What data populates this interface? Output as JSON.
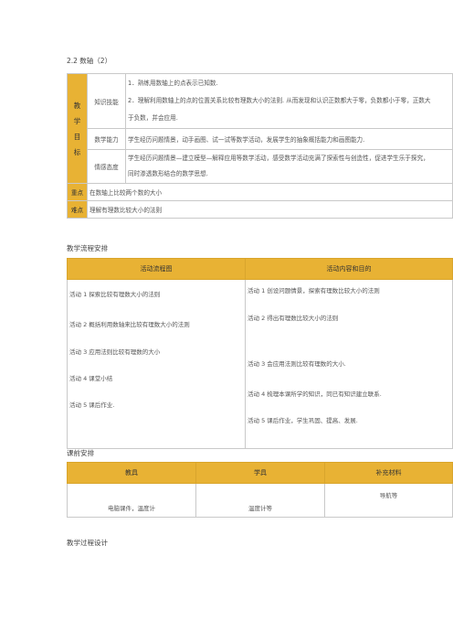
{
  "title": "2.2 数轴（2）",
  "goals": {
    "goal_label": "教学目标",
    "goal_chars": [
      "教",
      "学",
      "目",
      "标"
    ],
    "knowledge": {
      "label": "知识技能",
      "items": [
        "1．熟练用数轴上的点表示已知数.",
        "2．理解利用数轴上的点的位置关系比较有理数大小的法则. 从而发现和认识正数都大于零，负数都小于零，正数大",
        "于负数，并会应用."
      ]
    },
    "math_ability": {
      "label": "数学能力",
      "text": "学生经历问题情景，动手画图、试一试等数学活动，发展学生的抽象概括能力和画图能力."
    },
    "attitude": {
      "label": "情感态度",
      "lines": [
        "学生经历问题情景—建立模型—解释应用等数学活动，感受数学活动充满了探索性与创造性，促进学生乐于探究，",
        "同时渗透数形结合的数学思想."
      ]
    },
    "key_point": {
      "label": "重点",
      "text": "在数轴上比较两个数的大小"
    },
    "difficulty": {
      "label": "难点",
      "text": "理解有理数比较大小的法则"
    }
  },
  "flow_section": {
    "title": "教学流程安排",
    "col1": "活动流程图",
    "col2": "活动内容和目的",
    "left": [
      "活动 1 探索比较有理数大小的法则",
      "活动 2  概括利用数轴来比较有理数大小的法则",
      "活动 3  应用法则比较有理数的大小",
      "活动 4  课堂小结",
      "活动 5 课后作业."
    ],
    "right": [
      "活动 1 创设问题情景，探索有理数比较大小的法则",
      "活动 2 得出有理数比较大小的法则",
      "活动 3 会应用法则比较有理数的大小.",
      "活动 4 梳理本课所学的知识，同已有知识建立联系.",
      "活动 5 课后作业，学生巩固、提高、发展."
    ]
  },
  "prep_section": {
    "title": "课前安排",
    "headers": [
      "教具",
      "学具",
      "补充材料"
    ],
    "cells": [
      "电脑课件，温度计",
      "温度计等",
      "导航等"
    ]
  },
  "process_title": "教学过程设计",
  "colors": {
    "accent": "#e8b234",
    "border": "#c9c9c9"
  }
}
